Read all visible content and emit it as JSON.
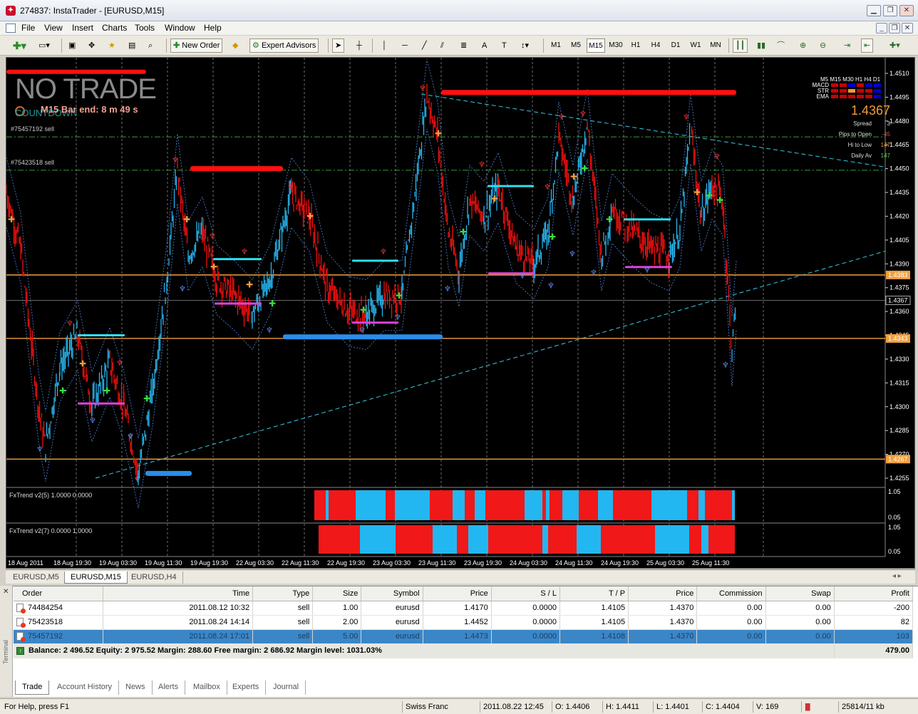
{
  "window": {
    "title": "274837: InstaTrader - [EURUSD,M15]"
  },
  "menu": [
    "File",
    "View",
    "Insert",
    "Charts",
    "Tools",
    "Window",
    "Help"
  ],
  "toolbar": {
    "new_order": "New Order",
    "expert_advisors": "Expert Advisors",
    "timeframes": [
      "M1",
      "M5",
      "M15",
      "M30",
      "H1",
      "H4",
      "D1",
      "W1",
      "MN"
    ],
    "active_timeframe": "M15"
  },
  "chart": {
    "symbol": "EURUSD,M15",
    "no_trade": "NO TRADE",
    "countdown": "COUNTDOWN",
    "bar_end": "M15 Bar end: 8 m 49 s",
    "order_lines": [
      "#75457192 sell",
      "#75423518 sell"
    ],
    "dashboard": {
      "timeframes": [
        "M5",
        "M15",
        "M30",
        "H1",
        "H4",
        "D1"
      ],
      "rows": [
        "MACD",
        "STR",
        "EMA"
      ],
      "price": "1.4367",
      "stats": [
        {
          "label": "Spread",
          "value": "3"
        },
        {
          "label": "Pips to Open",
          "value": "-45"
        },
        {
          "label": "Hi to Low",
          "value": "147"
        },
        {
          "label": "Daily Av",
          "value": "147"
        }
      ]
    },
    "price_scale": [
      "1.4510",
      "1.4495",
      "1.4480",
      "1.4465",
      "1.4450",
      "1.4435",
      "1.4420",
      "1.4405",
      "1.4390",
      "1.4375",
      "1.4360",
      "1.4345",
      "1.4330",
      "1.4315",
      "1.4300",
      "1.4285",
      "1.4270",
      "1.4255"
    ],
    "price_tags": [
      "1.4383",
      "1.4367",
      "1.4343",
      "1.4267"
    ],
    "time_axis": [
      "18 Aug 2011",
      "18 Aug 19:30",
      "19 Aug 03:30",
      "19 Aug 11:30",
      "19 Aug 19:30",
      "22 Aug 03:30",
      "22 Aug 11:30",
      "22 Aug 19:30",
      "23 Aug 03:30",
      "23 Aug 11:30",
      "23 Aug 19:30",
      "24 Aug 03:30",
      "24 Aug 11:30",
      "24 Aug 19:30",
      "25 Aug 03:30",
      "25 Aug 11:30"
    ],
    "indicator1": {
      "label": "FxTrend v2(5) 1.0000 0.0000",
      "scale_top": "1.05",
      "scale_bottom": "0.05"
    },
    "indicator2": {
      "label": "FxTrend v2(7) 0.0000 1.0000",
      "scale_top": "1.05",
      "scale_bottom": "0.05"
    }
  },
  "chart_tabs": [
    "EURUSD,M5",
    "EURUSD,M15",
    "EURUSD,H4"
  ],
  "orders": {
    "headers": [
      "Order",
      "Time",
      "Type",
      "Size",
      "Symbol",
      "Price",
      "S / L",
      "T / P",
      "Price",
      "Commission",
      "Swap",
      "Profit"
    ],
    "rows": [
      [
        "74484254",
        "2011.08.12 10:32",
        "sell",
        "1.00",
        "eurusd",
        "1.4170",
        "0.0000",
        "1.4105",
        "1.4370",
        "0.00",
        "0.00",
        "-200"
      ],
      [
        "75423518",
        "2011.08.24 14:14",
        "sell",
        "2.00",
        "eurusd",
        "1.4452",
        "0.0000",
        "1.4105",
        "1.4370",
        "0.00",
        "0.00",
        "82"
      ],
      [
        "75457192",
        "2011.08.24 17:01",
        "sell",
        "5.00",
        "eurusd",
        "1.4473",
        "0.0000",
        "1.4108",
        "1.4370",
        "0.00",
        "0.00",
        "103"
      ]
    ],
    "balance_text": "Balance: 2 496.52  Equity: 2 975.52  Margin: 288.60  Free margin: 2 686.92  Margin level: 1031.03%",
    "total_profit": "479.00"
  },
  "terminal_label": "Terminal",
  "terminal_tabs": [
    "Trade",
    "Account History",
    "News",
    "Alerts",
    "Mailbox",
    "Experts",
    "Journal"
  ],
  "status": {
    "help": "For Help, press F1",
    "profile": "Swiss Franc",
    "time": "2011.08.22 12:45",
    "open": "O: 1.4406",
    "high": "H: 1.4411",
    "low": "L: 1.4401",
    "close": "C: 1.4404",
    "volume": "V: 169",
    "traffic": "25814/11 kb"
  }
}
